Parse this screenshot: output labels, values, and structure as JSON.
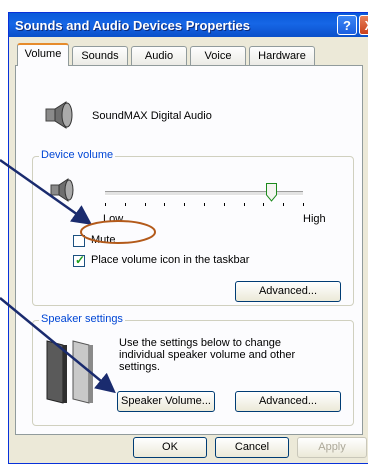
{
  "window": {
    "title": "Sounds and Audio Devices Properties",
    "help_label": "?",
    "close_label": "X"
  },
  "tabs": [
    {
      "label": "Volume",
      "active": true
    },
    {
      "label": "Sounds",
      "active": false
    },
    {
      "label": "Audio",
      "active": false
    },
    {
      "label": "Voice",
      "active": false
    },
    {
      "label": "Hardware",
      "active": false
    }
  ],
  "device_name": "SoundMAX Digital Audio",
  "device_volume": {
    "group_label": "Device volume",
    "low_label": "Low",
    "high_label": "High",
    "level": 0.84,
    "mute_label": "Mute",
    "mute_checked": false,
    "taskbar_label": "Place volume icon in the taskbar",
    "taskbar_checked": true,
    "advanced_label": "Advanced..."
  },
  "speaker_settings": {
    "group_label": "Speaker settings",
    "description": "Use the settings below to change individual speaker volume and other settings.",
    "speaker_volume_label": "Speaker Volume...",
    "advanced_label": "Advanced..."
  },
  "footer": {
    "ok_label": "OK",
    "cancel_label": "Cancel",
    "apply_label": "Apply"
  },
  "colors": {
    "annotation_arrow": "#1a2b6e",
    "annotation_ellipse": "#b35a1a",
    "group_label": "#0046d5",
    "title_bar": "#0a5ad9"
  }
}
